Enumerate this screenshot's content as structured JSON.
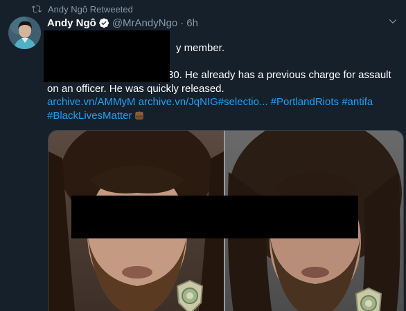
{
  "retweet": {
    "icon": "retweet-icon",
    "label": "Andy Ngô Retweeted"
  },
  "author": {
    "display_name": "Andy Ngô",
    "handle": "@MrAndyNgo",
    "separator": "·",
    "time": "6h",
    "verified": true
  },
  "body": {
    "line1": "y member.",
    "line2_pre": "",
    "line2_tail": "30. He already has a previous charge for assault",
    "line3": "on an officer. He was quickly released.",
    "links": [
      {
        "text": "archive.vn/AMMyM"
      },
      {
        "text": "archive.vn/JqNIG#selectio..."
      },
      {
        "text": "#PortlandRiots"
      },
      {
        "text": "#antifa"
      },
      {
        "text": "#BlackLivesMatter"
      }
    ],
    "emoji": "fist-emoji"
  },
  "colors": {
    "background": "#15202b",
    "accent": "#1da1f2",
    "muted": "#8899a6",
    "text": "#ffffff"
  }
}
